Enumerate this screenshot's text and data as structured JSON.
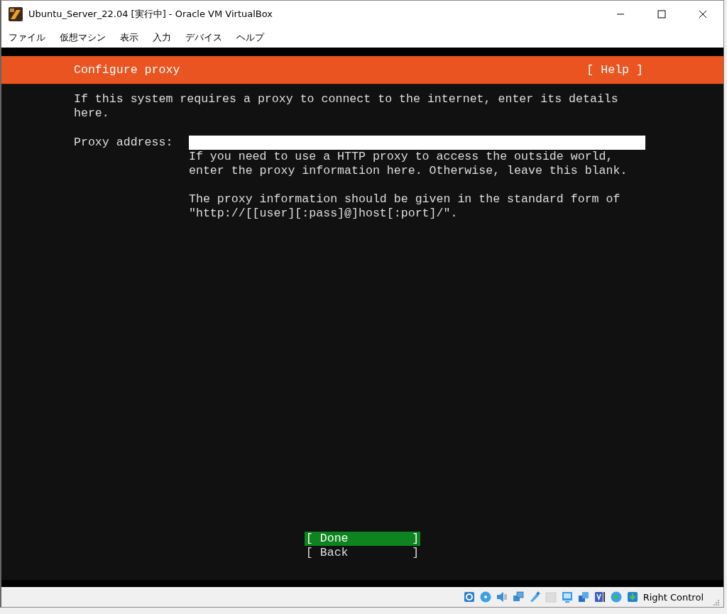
{
  "window": {
    "title": "Ubuntu_Server_22.04 [実行中] - Oracle VM VirtualBox"
  },
  "menu_bar": [
    "ファイル",
    "仮想マシン",
    "表示",
    "入力",
    "デバイス",
    "ヘルプ"
  ],
  "installer": {
    "header": {
      "title": "Configure proxy",
      "help": "[ Help ]"
    },
    "intro": "If this system requires a proxy to connect to the internet, enter its details here.",
    "proxy_field": {
      "label": "Proxy address:"
    },
    "help_paragraphs": [
      "If you need to use a HTTP proxy to access the outside world, enter the proxy information here. Otherwise, leave this blank.",
      "The proxy information should be given in the standard form of \"http://[[user][:pass]@]host[:port]/\"."
    ],
    "buttons": [
      {
        "label": "[ Done         ]",
        "selected": true
      },
      {
        "label": "[ Back         ]",
        "selected": false
      }
    ]
  },
  "status_bar": {
    "host_key": "Right Control"
  }
}
